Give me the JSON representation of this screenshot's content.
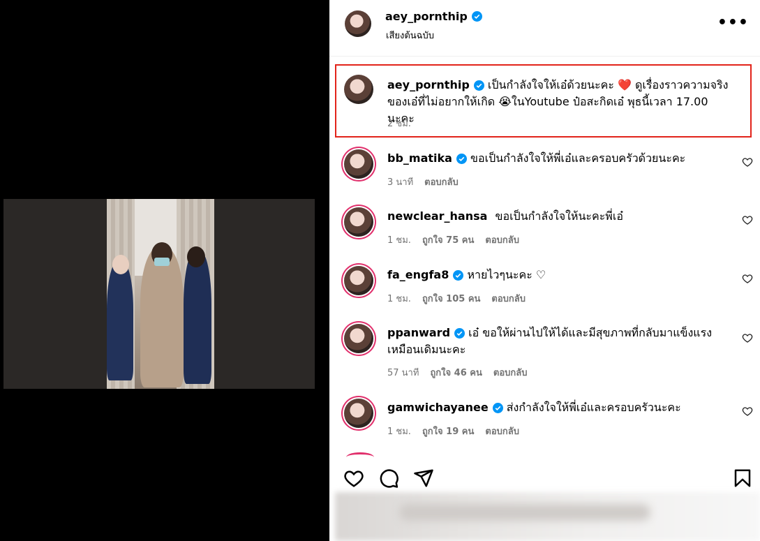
{
  "post": {
    "username": "aey_pornthip",
    "subtitle": "เสียงต้นฉบับ",
    "more_label": "•••",
    "caption": {
      "username": "aey_pornthip",
      "text": "เป็นกำลังใจให้เอ๋ด้วยนะคะ ❤️ ดูเรื่องราวความจริงของเอ๋ที่ไม่อยากให้เกิด 😭ในYoutube ป๋อสะกิดเอ๋ พุธนี้เวลา 17.00 นะคะ",
      "time": "2 ชม."
    }
  },
  "comments": [
    {
      "username": "bb_matika",
      "text": "ขอเป็นกำลังใจให้พี่เอ๋และครอบครัวด้วยนะคะ",
      "time": "3 นาที",
      "likes": "",
      "reply": "ตอบกลับ"
    },
    {
      "username": "newclear_hansa",
      "text": "ขอเป็นกำลังใจให้นะคะพี่เอ๋",
      "time": "1 ชม.",
      "likes": "ถูกใจ 75 คน",
      "reply": "ตอบกลับ"
    },
    {
      "username": "fa_engfa8",
      "text": "หายไวๆนะคะ ♡",
      "time": "1 ชม.",
      "likes": "ถูกใจ 105 คน",
      "reply": "ตอบกลับ"
    },
    {
      "username": "ppanward",
      "text": "เอ๋ ขอให้ผ่านไปให้ได้และมีสุขภาพที่กลับมาแข็งแรงเหมือนเดิมนะคะ",
      "time": "57 นาที",
      "likes": "ถูกใจ 46 คน",
      "reply": "ตอบกลับ"
    },
    {
      "username": "gamwichayanee",
      "text": "ส่งกำลังใจให้พี่เอ๋และครอบครัวนะคะ",
      "time": "1 ชม.",
      "likes": "ถูกใจ 19 คน",
      "reply": "ตอบกลับ"
    }
  ],
  "colors": {
    "verified": "#0095f6",
    "highlight": "#e2231a",
    "ring": "#e1306c",
    "meta": "#737373"
  },
  "icons": [
    "like-icon",
    "comment-icon",
    "share-icon",
    "save-icon",
    "verified-icon",
    "more-icon",
    "heart-small-icon"
  ]
}
